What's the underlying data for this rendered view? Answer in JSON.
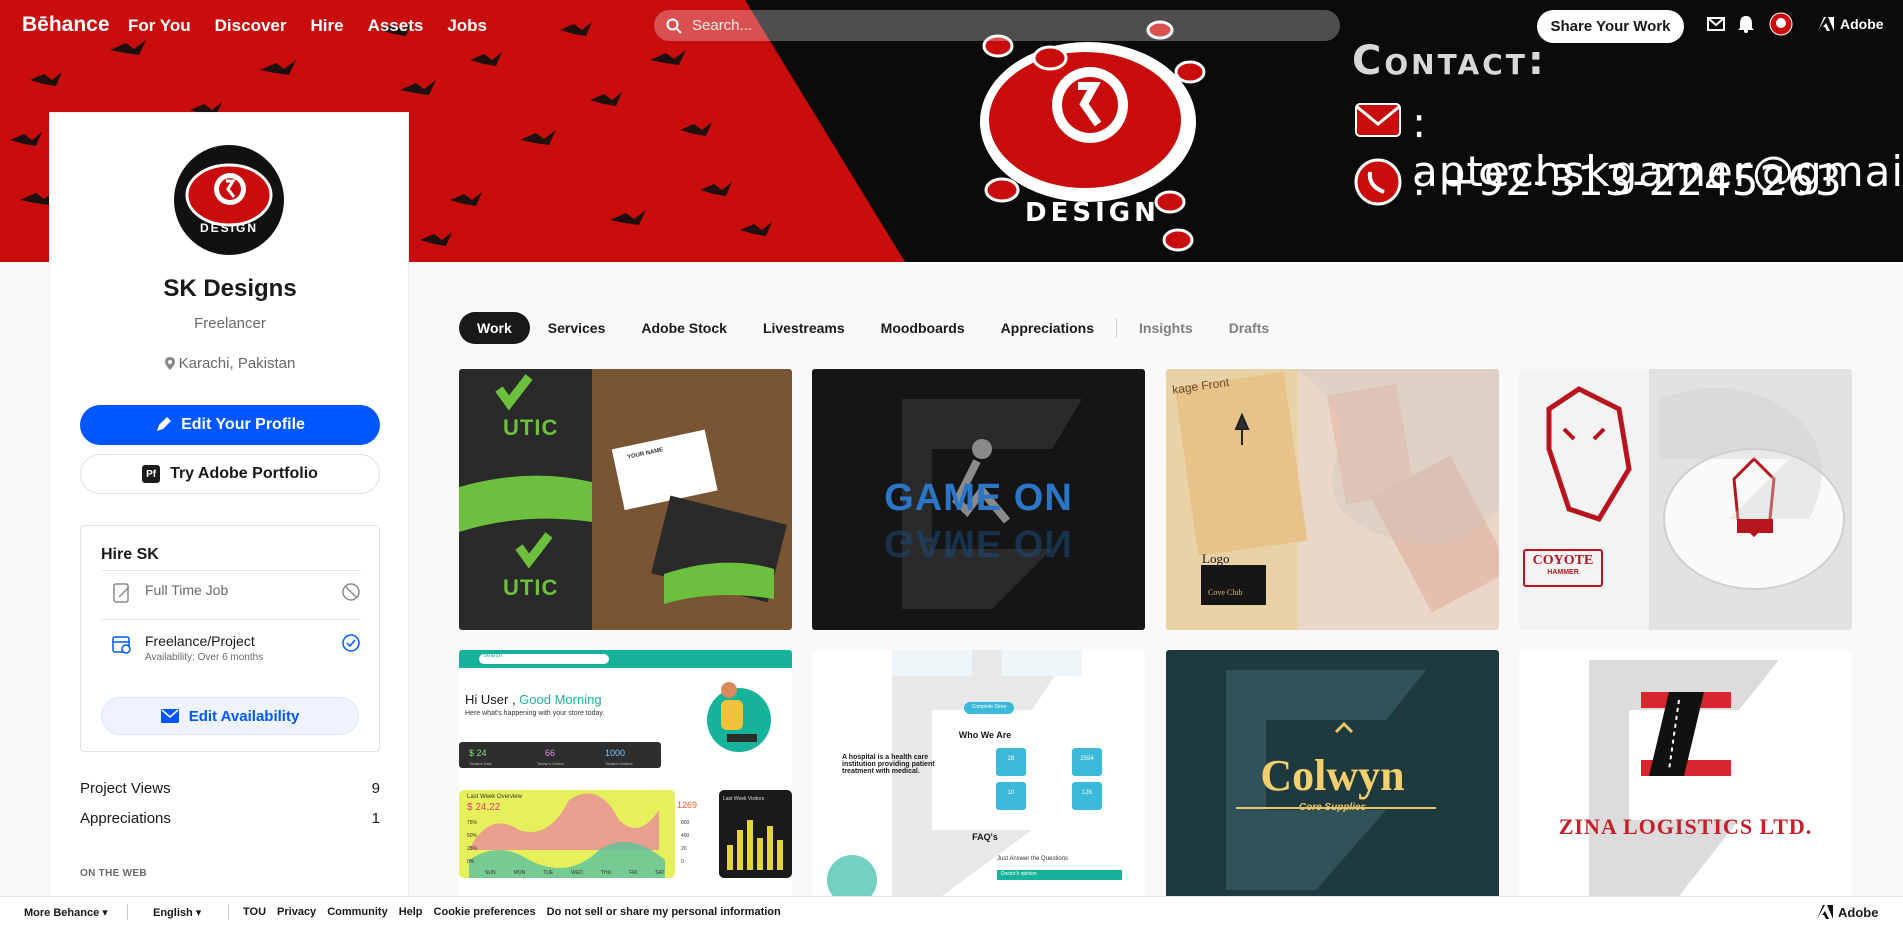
{
  "app": {
    "logo": "Bēhance"
  },
  "topnav": {
    "links": [
      "For You",
      "Discover",
      "Hire",
      "Assets",
      "Jobs"
    ],
    "search_placeholder": "Search...",
    "share_label": "Share Your Work",
    "adobe_label": "Adobe",
    "icons": [
      "mail-icon",
      "bell-icon",
      "avatar",
      "adobe-icon"
    ]
  },
  "banner": {
    "contact_title": "Contact:",
    "email": ": aptechskgamer@gmail.com",
    "phone": ": +92-313-2245263",
    "brand": "DESIGN",
    "colors": {
      "red": "#c90d0d",
      "black": "#0b0b0b"
    }
  },
  "profile": {
    "name": "SK Designs",
    "occupation": "Freelancer",
    "location": "Karachi, Pakistan",
    "edit_label": "Edit Your Profile",
    "portfolio_label": "Try Adobe Portfolio",
    "portfolio_badge": "Pf",
    "avatar_text": "DESIGN",
    "hire": {
      "title": "Hire SK",
      "full_time": "Full Time Job",
      "freelance": "Freelance/Project",
      "availability": "Availability: Over 6 months",
      "edit_availability": "Edit Availability"
    },
    "stats": {
      "views_label": "Project Views",
      "views": "9",
      "appreciations_label": "Appreciations",
      "appreciations": "1"
    },
    "on_the_web": "ON THE WEB"
  },
  "tabs": [
    {
      "label": "Work",
      "active": true
    },
    {
      "label": "Services"
    },
    {
      "label": "Adobe Stock"
    },
    {
      "label": "Livestreams"
    },
    {
      "label": "Moodboards"
    },
    {
      "label": "Appreciations"
    },
    {
      "label": "Insights",
      "muted": true
    },
    {
      "label": "Drafts",
      "muted": true
    }
  ],
  "projects": {
    "p1": {
      "title": "UTIC",
      "card_name": "YOUR NAME"
    },
    "p2": {
      "title": "GAME ON"
    },
    "p3": {
      "title": "Cove Club",
      "label_front": "kage Front",
      "label_logo": "Logo"
    },
    "p4": {
      "title": "COYOTE",
      "sub": "HAMMER"
    },
    "p5": {
      "greeting": "Hi User , ",
      "greeting_accent": "Good Morning",
      "subtitle": "Here what's happening with your store today.",
      "search": "Search",
      "stats": [
        "$ 24",
        "66",
        "1000"
      ],
      "stat_labels": [
        "Today's Sale",
        "Today's Orders",
        "Today's Visitors"
      ],
      "chart_title": "Last Week Overview",
      "chart_value": "$ 24,22",
      "chart_badge": "1269",
      "visits_title": "Last Week Visitors",
      "days": [
        "SUN",
        "MON",
        "TUE",
        "WED",
        "THU",
        "FRI",
        "SAT"
      ],
      "yticks": [
        "75%",
        "50%",
        "25%",
        "0%"
      ],
      "yticks_r": [
        "800",
        "400",
        "20",
        "0"
      ]
    },
    "p6": {
      "button": "Complete Store",
      "heading": "Who We Are",
      "body": "A hospital is a health care institution providing patient treatment with medical.",
      "faq": "FAQ's",
      "faq_sub": "Just Answer the Questions",
      "faq_q": "Doctor's opinion",
      "counts": [
        "28",
        "2554",
        "10",
        "128"
      ]
    },
    "p7": {
      "title": "Colwyn",
      "sub": "Core Supplies"
    },
    "p8": {
      "title": "ZINA LOGISTICS LTD."
    }
  },
  "footer": {
    "more": "More Behance",
    "language": "English",
    "links": [
      "TOU",
      "Privacy",
      "Community",
      "Help",
      "Cookie preferences",
      "Do not sell or share my personal information"
    ],
    "adobe": "Adobe"
  }
}
